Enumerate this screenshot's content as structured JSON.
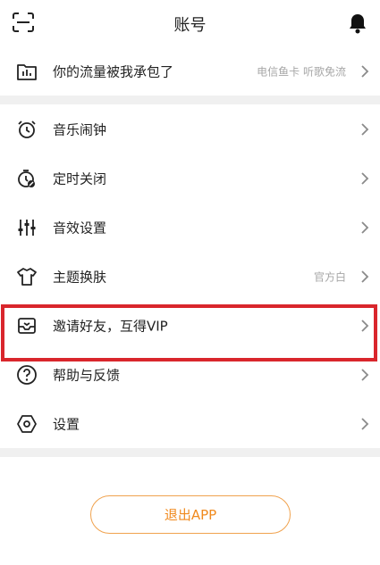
{
  "header": {
    "title": "账号",
    "left_icon": "scan-icon",
    "right_icon": "bell-icon"
  },
  "section1": [
    {
      "label": "你的流量被我承包了",
      "sub": "电信鱼卡 听歌免流",
      "icon": "folder-chart-icon"
    }
  ],
  "section2": [
    {
      "label": "音乐闹钟",
      "sub": "",
      "icon": "alarm-clock-icon"
    },
    {
      "label": "定时关闭",
      "sub": "",
      "icon": "timer-off-icon"
    },
    {
      "label": "音效设置",
      "sub": "",
      "icon": "equalizer-icon"
    },
    {
      "label": "主题换肤",
      "sub": "官方白",
      "icon": "tshirt-icon"
    },
    {
      "label": "邀请好友，互得VIP",
      "sub": "",
      "icon": "invite-inbox-icon"
    },
    {
      "label": "帮助与反馈",
      "sub": "",
      "icon": "help-icon"
    },
    {
      "label": "设置",
      "sub": "",
      "icon": "settings-hex-icon"
    }
  ],
  "logout_label": "退出APP",
  "colors": {
    "accent": "#f08a1e",
    "highlight": "#d9262c",
    "separator": "#f0f0f0"
  }
}
